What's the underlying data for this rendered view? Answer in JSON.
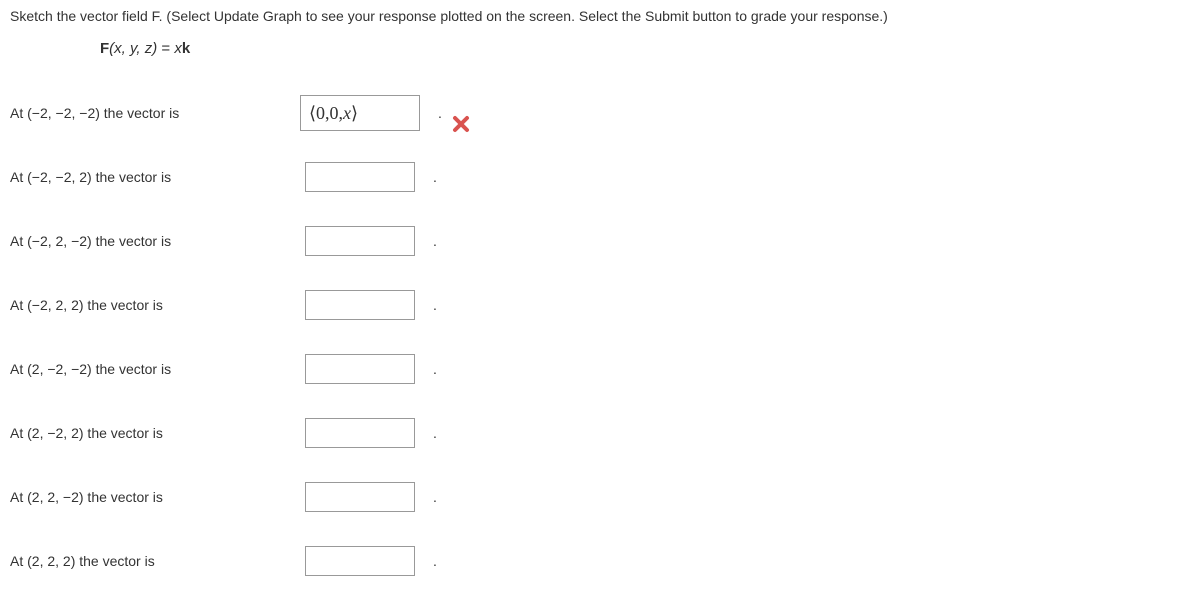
{
  "instructions": "Sketch the vector field F. (Select Update Graph to see your response plotted on the screen. Select the Submit button to grade your response.)",
  "equation": {
    "lhs_func": "F",
    "lhs_args": "(x, y, z)",
    "eq": " = ",
    "rhs_coef": "x",
    "rhs_vec": "k"
  },
  "rows": [
    {
      "label": "At (−2, −2, −2) the vector is",
      "value": "⟨0,0,x⟩",
      "wide": true,
      "mark": "wrong",
      "period": "."
    },
    {
      "label": "At (−2, −2, 2) the vector is",
      "value": "",
      "wide": false,
      "mark": "",
      "period": "."
    },
    {
      "label": "At (−2, 2, −2) the vector is",
      "value": "",
      "wide": false,
      "mark": "",
      "period": "."
    },
    {
      "label": "At (−2, 2, 2) the vector is",
      "value": "",
      "wide": false,
      "mark": "",
      "period": "."
    },
    {
      "label": "At (2, −2, −2) the vector is",
      "value": "",
      "wide": false,
      "mark": "",
      "period": "."
    },
    {
      "label": "At (2, −2, 2) the vector is",
      "value": "",
      "wide": false,
      "mark": "",
      "period": "."
    },
    {
      "label": "At (2, 2, −2) the vector is",
      "value": "",
      "wide": false,
      "mark": "",
      "period": "."
    },
    {
      "label": "At (2, 2, 2) the vector is",
      "value": "",
      "wide": false,
      "mark": "",
      "period": "."
    }
  ]
}
